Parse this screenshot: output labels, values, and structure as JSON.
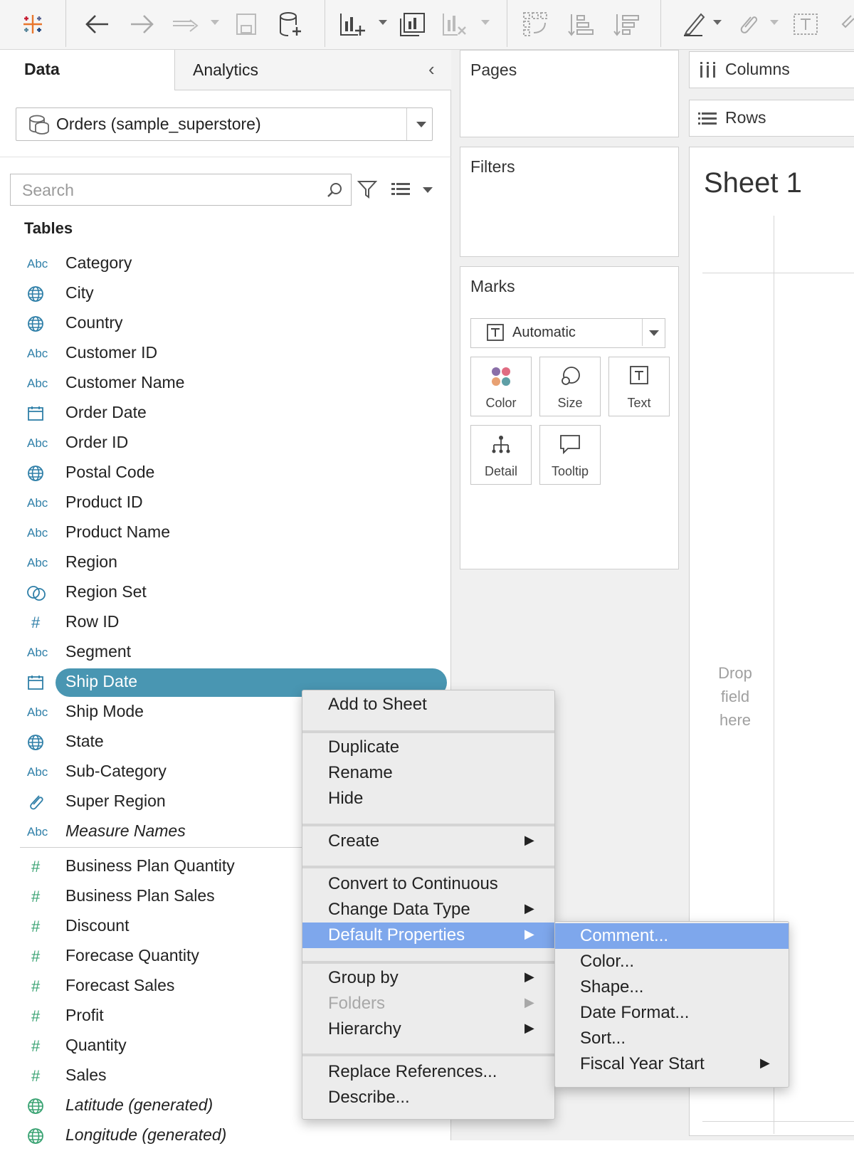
{
  "tabs": {
    "data": "Data",
    "analytics": "Analytics"
  },
  "datasource": {
    "name": "Orders (sample_superstore)"
  },
  "search": {
    "placeholder": "Search"
  },
  "tables_heading": "Tables",
  "fields": [
    {
      "name": "Category",
      "type_label": "Abc",
      "icon": "abc-icon"
    },
    {
      "name": "City",
      "type_label": "",
      "icon": "globe-icon"
    },
    {
      "name": "Country",
      "type_label": "",
      "icon": "globe-icon"
    },
    {
      "name": "Customer ID",
      "type_label": "Abc",
      "icon": "abc-icon"
    },
    {
      "name": "Customer Name",
      "type_label": "Abc",
      "icon": "abc-icon"
    },
    {
      "name": "Order Date",
      "type_label": "",
      "icon": "calendar-icon"
    },
    {
      "name": "Order ID",
      "type_label": "Abc",
      "icon": "abc-icon"
    },
    {
      "name": "Postal Code",
      "type_label": "",
      "icon": "globe-icon"
    },
    {
      "name": "Product ID",
      "type_label": "Abc",
      "icon": "abc-icon"
    },
    {
      "name": "Product Name",
      "type_label": "Abc",
      "icon": "abc-icon"
    },
    {
      "name": "Region",
      "type_label": "Abc",
      "icon": "abc-icon"
    },
    {
      "name": "Region Set",
      "type_label": "",
      "icon": "set-icon"
    },
    {
      "name": "Row ID",
      "type_label": "#",
      "icon": "number-icon"
    },
    {
      "name": "Segment",
      "type_label": "Abc",
      "icon": "abc-icon"
    },
    {
      "name": "Ship Date",
      "type_label": "",
      "icon": "calendar-icon",
      "selected": true
    },
    {
      "name": "Ship Mode",
      "type_label": "Abc",
      "icon": "abc-icon"
    },
    {
      "name": "State",
      "type_label": "",
      "icon": "globe-icon"
    },
    {
      "name": "Sub-Category",
      "type_label": "Abc",
      "icon": "abc-icon"
    },
    {
      "name": "Super Region",
      "type_label": "",
      "icon": "paperclip-icon"
    },
    {
      "name": "Measure Names",
      "type_label": "Abc",
      "icon": "abc-icon",
      "italic": true
    }
  ],
  "measures": [
    {
      "name": "Business Plan Quantity",
      "type_label": "#",
      "icon": "number-icon"
    },
    {
      "name": "Business Plan Sales",
      "type_label": "#",
      "icon": "number-icon"
    },
    {
      "name": "Discount",
      "type_label": "#",
      "icon": "number-icon"
    },
    {
      "name": "Forecase Quantity",
      "type_label": "#",
      "icon": "number-icon"
    },
    {
      "name": "Forecast Sales",
      "type_label": "#",
      "icon": "number-icon"
    },
    {
      "name": "Profit",
      "type_label": "#",
      "icon": "number-icon"
    },
    {
      "name": "Quantity",
      "type_label": "#",
      "icon": "number-icon"
    },
    {
      "name": "Sales",
      "type_label": "#",
      "icon": "number-icon"
    },
    {
      "name": "Latitude (generated)",
      "type_label": "",
      "icon": "globe-icon",
      "italic": true
    },
    {
      "name": "Longitude (generated)",
      "type_label": "",
      "icon": "globe-icon",
      "italic": true
    }
  ],
  "shelves": {
    "pages": "Pages",
    "filters": "Filters",
    "marks": "Marks",
    "columns": "Columns",
    "rows": "Rows"
  },
  "marks": {
    "type": "Automatic",
    "cards": [
      "Color",
      "Size",
      "Text",
      "Detail",
      "Tooltip"
    ]
  },
  "sheet": {
    "title": "Sheet 1",
    "drop_hint": [
      "Drop",
      "field",
      "here"
    ]
  },
  "context_menu": {
    "items": [
      {
        "label": "Add to Sheet"
      },
      {
        "label": "Duplicate"
      },
      {
        "label": "Rename"
      },
      {
        "label": "Hide"
      },
      {
        "label": "Create",
        "submenu": true
      },
      {
        "label": "Convert to Continuous"
      },
      {
        "label": "Change Data Type",
        "submenu": true
      },
      {
        "label": "Default Properties",
        "submenu": true,
        "highlighted": true
      },
      {
        "label": "Group by",
        "submenu": true
      },
      {
        "label": "Folders",
        "submenu": true,
        "disabled": true
      },
      {
        "label": "Hierarchy",
        "submenu": true
      },
      {
        "label": "Replace References..."
      },
      {
        "label": "Describe..."
      }
    ],
    "arrow": "▶"
  },
  "submenu": {
    "items": [
      {
        "label": "Comment...",
        "highlighted": true
      },
      {
        "label": "Color..."
      },
      {
        "label": "Shape..."
      },
      {
        "label": "Date Format..."
      },
      {
        "label": "Sort..."
      },
      {
        "label": "Fiscal Year Start",
        "submenu": true
      }
    ]
  },
  "colors": {
    "selected_pill": "#4996b2",
    "menu_highlight": "#7ea7ec",
    "dimension": "#2f7fa8",
    "measure": "#3aa373"
  }
}
